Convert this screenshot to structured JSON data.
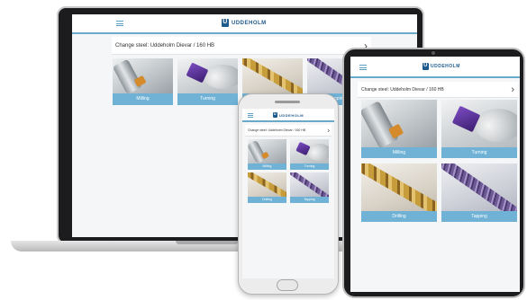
{
  "app": {
    "logo_text": "UDDEHOLM",
    "logo_mark": "U",
    "menu_icon": "hamburger-menu-icon",
    "steel_selector": "Change steel: Uddeholm Dievar / 160 HB",
    "chevron": "›"
  },
  "tiles": [
    {
      "label": "Milling"
    },
    {
      "label": "Turning"
    },
    {
      "label": "Drilling"
    },
    {
      "label": "Tapping"
    }
  ],
  "colors": {
    "accent": "#6fb2d6",
    "brand": "#1e5a8c",
    "device_frame": "#1c1c1e"
  }
}
